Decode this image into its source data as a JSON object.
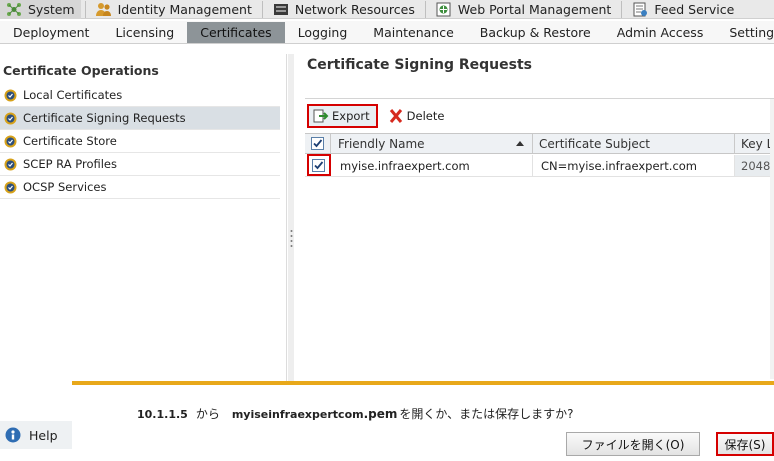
{
  "top_nav": [
    {
      "label": "System",
      "icon": "system-icon"
    },
    {
      "label": "Identity Management",
      "icon": "identity-icon"
    },
    {
      "label": "Network Resources",
      "icon": "network-icon"
    },
    {
      "label": "Web Portal Management",
      "icon": "web-portal-icon"
    },
    {
      "label": "Feed Service",
      "icon": "feed-icon"
    }
  ],
  "sub_nav": [
    "Deployment",
    "Licensing",
    "Certificates",
    "Logging",
    "Maintenance",
    "Backup & Restore",
    "Admin Access",
    "Settings"
  ],
  "sub_nav_active": "Certificates",
  "left_panel": {
    "title": "Certificate Operations",
    "items": [
      "Local Certificates",
      "Certificate Signing Requests",
      "Certificate Store",
      "SCEP RA Profiles",
      "OCSP Services"
    ],
    "selected": "Certificate Signing Requests"
  },
  "help": {
    "label": "Help"
  },
  "main": {
    "title": "Certificate Signing Requests",
    "toolbar": {
      "export_label": "Export",
      "delete_label": "Delete"
    },
    "columns": [
      "Friendly Name",
      "Certificate Subject",
      "Key Le"
    ],
    "rows": [
      {
        "friendly_name": "myise.infraexpert.com",
        "subject": "CN=myise.infraexpert.com",
        "key_length": "2048",
        "checked": true
      }
    ]
  },
  "download_bar": {
    "host": "10.1.1.5",
    "from": "から",
    "filename": "myiseinfraexpertcom",
    "extension": ".pem",
    "question": "を開くか、または保存しますか?",
    "open_label": "ファイルを開く(O)",
    "save_label": "保存(S)"
  },
  "colors": {
    "highlight_red": "#d50000",
    "download_bar_accent": "#e8a81a",
    "active_tab": "#8d9498"
  }
}
